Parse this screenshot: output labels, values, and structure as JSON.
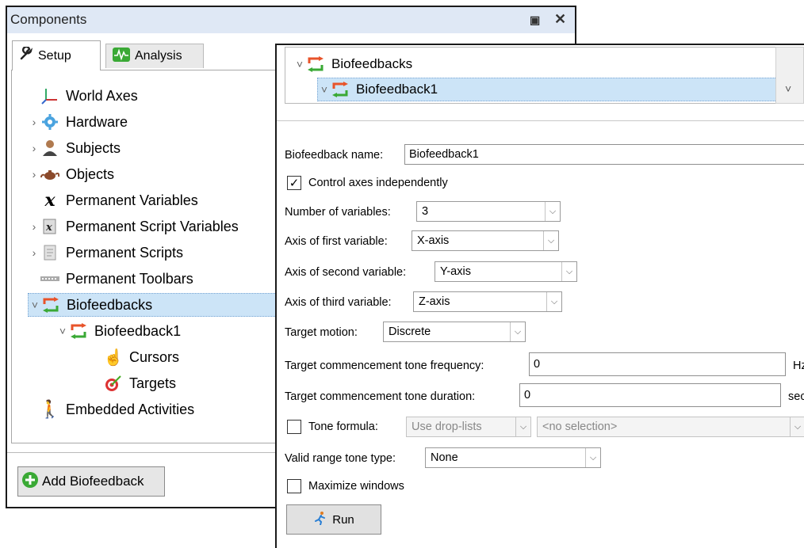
{
  "panel": {
    "title": "Components",
    "float_icon": "▣",
    "close_icon": "✕",
    "tabs": [
      {
        "label": "Setup",
        "icon": "wrench-icon"
      },
      {
        "label": "Analysis",
        "icon": "waveform-icon"
      }
    ],
    "tree": [
      {
        "label": "World Axes",
        "icon": "axes-icon",
        "chevron": ""
      },
      {
        "label": "Hardware",
        "icon": "gear-icon",
        "chevron": "›"
      },
      {
        "label": "Subjects",
        "icon": "person-icon",
        "chevron": "›"
      },
      {
        "label": "Objects",
        "icon": "teapot-icon",
        "chevron": "›"
      },
      {
        "label": "Permanent Variables",
        "icon": "variable-x-icon",
        "chevron": ""
      },
      {
        "label": "Permanent Script Variables",
        "icon": "script-variable-icon",
        "chevron": "›"
      },
      {
        "label": "Permanent Scripts",
        "icon": "script-icon",
        "chevron": "›"
      },
      {
        "label": "Permanent Toolbars",
        "icon": "toolbar-icon",
        "chevron": ""
      },
      {
        "label": "Biofeedbacks",
        "icon": "biofeedback-icon",
        "chevron": "˅"
      },
      {
        "label": "Biofeedback1",
        "icon": "biofeedback-icon",
        "chevron": "˅"
      },
      {
        "label": "Cursors",
        "icon": "hand-cursor-icon",
        "chevron": ""
      },
      {
        "label": "Targets",
        "icon": "target-icon",
        "chevron": ""
      },
      {
        "label": "Embedded Activities",
        "icon": "walking-icon",
        "chevron": ""
      }
    ],
    "add_button_label": "Add Biofeedback"
  },
  "detail": {
    "mini_tree": [
      {
        "label": "Biofeedbacks",
        "chevron": "˅"
      },
      {
        "label": "Biofeedback1",
        "chevron": "˅"
      }
    ],
    "mini_scroll_arrow": "˅",
    "name_label": "Biofeedback name:",
    "name_value": "Biofeedback1",
    "control_axes_label": "Control axes independently",
    "control_axes_checked": true,
    "num_vars_label": "Number of variables:",
    "num_vars_value": "3",
    "axis1_label": "Axis of first variable:",
    "axis1_value": "X-axis",
    "axis2_label": "Axis of second variable:",
    "axis2_value": "Y-axis",
    "axis3_label": "Axis of third variable:",
    "axis3_value": "Z-axis",
    "target_motion_label": "Target motion:",
    "target_motion_value": "Discrete",
    "tone_freq_label": "Target commencement tone frequency:",
    "tone_freq_value": "0",
    "tone_freq_unit": "Hz",
    "tone_dur_label": "Target commencement tone duration:",
    "tone_dur_value": "0",
    "tone_dur_unit": "sec",
    "tone_formula_label": "Tone formula:",
    "tone_formula_checked": false,
    "tone_formula_mode": "Use drop-lists",
    "tone_formula_selection": "<no selection>",
    "valid_range_label": "Valid range tone type:",
    "valid_range_value": "None",
    "maximize_label": "Maximize windows",
    "maximize_checked": false,
    "run_label": "Run"
  },
  "colors": {
    "selection": "#cce4f7",
    "titlebar": "#dfe8f5",
    "biofeedback_orange": "#e8532a",
    "biofeedback_green": "#3aa935"
  }
}
